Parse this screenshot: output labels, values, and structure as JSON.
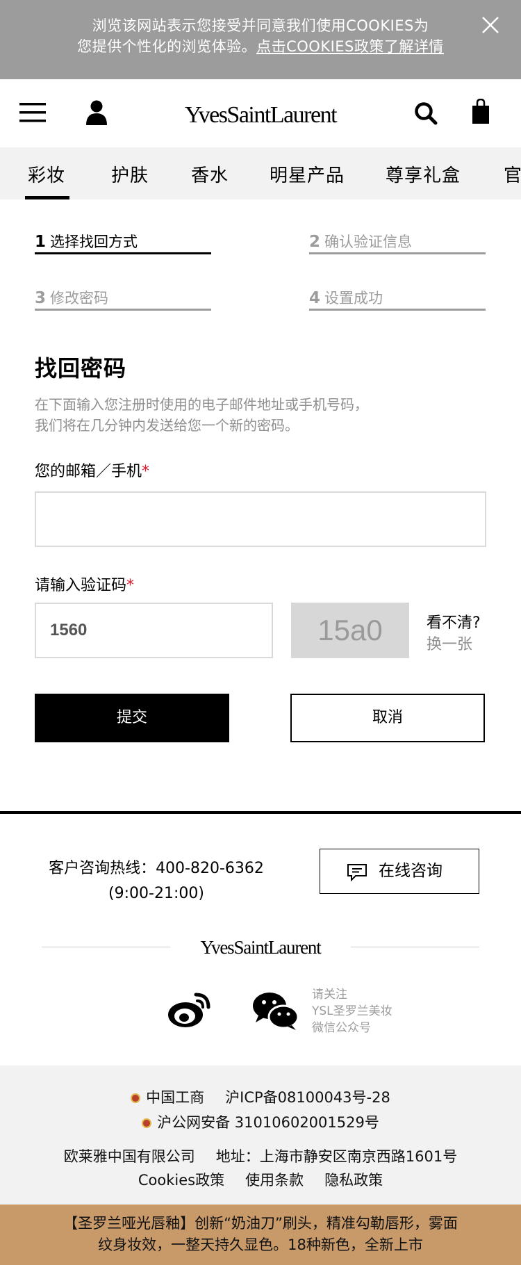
{
  "cookie_banner": {
    "line1": "浏览该网站表示您接受并同意我们使用COOKIES为",
    "line2_prefix": "您提供个性化的浏览体验。",
    "line2_link": "点击COOKIES政策了解详情"
  },
  "header": {
    "logo_text": "YvesSaintLaurent"
  },
  "nav": {
    "items": [
      "彩妆",
      "护肤",
      "香水",
      "明星产品",
      "尊享礼盒",
      "官"
    ]
  },
  "steps": [
    {
      "num": "1",
      "label": "选择找回方式"
    },
    {
      "num": "2",
      "label": "确认验证信息"
    },
    {
      "num": "3",
      "label": "修改密码"
    },
    {
      "num": "4",
      "label": "设置成功"
    }
  ],
  "form": {
    "title": "找回密码",
    "desc_line1": "在下面输入您注册时使用的电子邮件地址或手机号码，",
    "desc_line2": "我们将在几分钟内发送给您一个新的密码。",
    "email_label": "您的邮箱／手机",
    "required_mark": "*",
    "email_value": "",
    "code_label": "请输入验证码",
    "code_value": "1560",
    "captcha_text": "15a0",
    "unclear_text": "看不清?",
    "change_text": "换一张",
    "submit_label": "提交",
    "cancel_label": "取消"
  },
  "footer": {
    "hotline_line1": "客户咨询热线：400-820-6362",
    "hotline_line2": "(9:00-21:00)",
    "consult_label": "在线咨询",
    "follow_line1": "请关注",
    "follow_line2": "YSL圣罗兰美妆",
    "follow_line3": "微信公众号",
    "icp_prefix": "中国工商",
    "icp": "沪ICP备08100043号-28",
    "police": "沪公网安备 31010602001529号",
    "company": "欧莱雅中国有限公司",
    "address": "地址：上海市静安区南京西路1601号",
    "links": [
      "Cookies政策",
      "使用条款",
      "隐私政策"
    ],
    "promo_line1": "【圣罗兰哑光唇釉】创新“奶油刀”刷头，精准勾勒唇形，雾面",
    "promo_line2": "纹身妆效，一整天持久显色。18种新色，全新上市"
  },
  "colors": {
    "banner_bg": "#9c9c9c",
    "nav_bg": "#f2f2f2",
    "required": "#e0162b",
    "promo_bg": "#c89a6a"
  }
}
